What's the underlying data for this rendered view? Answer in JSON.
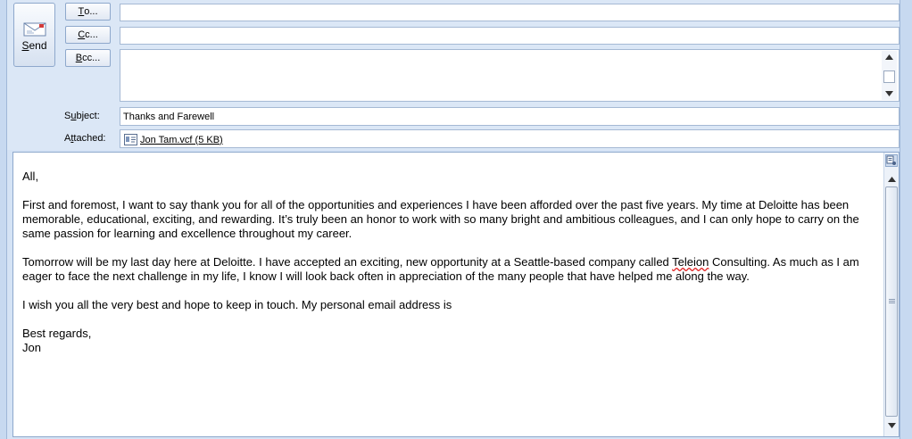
{
  "compose": {
    "send_label_acc": "S",
    "send_label_rest": "end",
    "to_button_acc": "T",
    "to_button_rest": "o...",
    "cc_button_acc": "C",
    "cc_button_rest": "c...",
    "bcc_button_acc": "B",
    "bcc_button_rest": "cc...",
    "to_value": "",
    "cc_value": "",
    "bcc_value": "",
    "subject_label_pre": "S",
    "subject_label_acc": "u",
    "subject_label_post": "bject:",
    "subject_value": "Thanks and Farewell",
    "attached_label_pre": "A",
    "attached_label_acc": "t",
    "attached_label_post": "tached:",
    "attachment_name": "Jon Tam.vcf (5 KB)"
  },
  "body": {
    "greeting": "All,",
    "para1": "First and foremost, I want to say thank you for all of the opportunities and experiences I have been afforded over the past five years.  My time at Deloitte has been memorable, educational, exciting, and rewarding.  It’s truly been an honor to work with so many bright and ambitious colleagues, and I can only hope to carry on the same passion for learning and excellence throughout my career.",
    "para2_before": "Tomorrow will be my last day here at Deloitte.  I have accepted an exciting, new opportunity at a Seattle-based company called ",
    "para2_misspelled": "Teleion",
    "para2_after": " Consulting.  As much as I am eager to face the next challenge in my life, I know I will look back often in appreciation of the many people that have helped me along the way.",
    "para3": "I wish you all the very best and hope to keep in touch.  My personal email address is",
    "closing": "Best regards,",
    "signature": "Jon"
  },
  "icons": {
    "send": "envelope-send-icon",
    "attachment": "vcard-file-icon",
    "scroll_up": "arrow-up-icon",
    "scroll_down": "arrow-down-icon",
    "formatting": "formatting-toggle-icon"
  },
  "colors": {
    "frame_bg": "#d5e3f5",
    "border": "#8ea8cc",
    "spell_error": "#e02020"
  }
}
